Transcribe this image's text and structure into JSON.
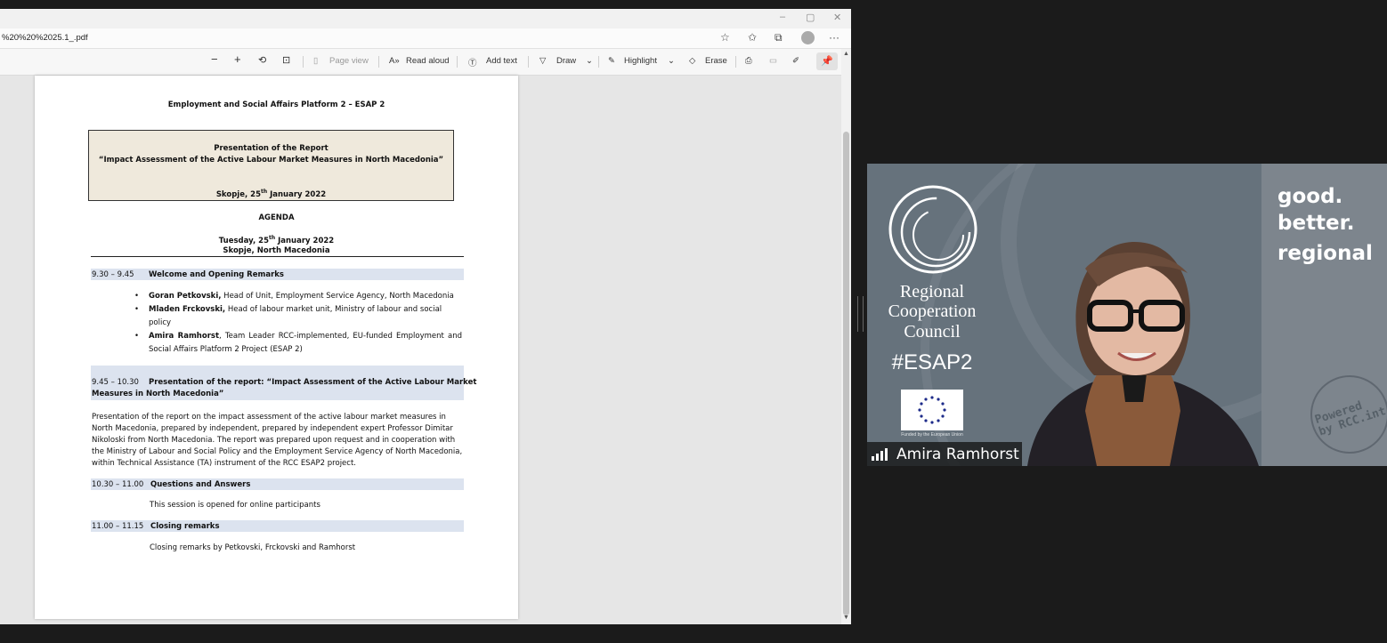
{
  "browser": {
    "url": "%20%20%2025.1_.pdf",
    "window_controls": [
      "–",
      "▢",
      "✕"
    ],
    "address_icons": [
      "favorite-add-icon",
      "favorites-icon",
      "collections-icon",
      "profile-icon",
      "more-icon"
    ],
    "more_label": "···"
  },
  "pdf_toolbar": {
    "zoom_out": "−",
    "zoom_in": "+",
    "page_view": "Page view",
    "read_aloud": "Read aloud",
    "add_text": "Add text",
    "draw": "Draw",
    "highlight": "Highlight",
    "erase": "Erase",
    "pin": "📌"
  },
  "document": {
    "header": "Employment and Social Affairs Platform 2 – ESAP 2",
    "box": {
      "line1": "Presentation of the Report",
      "line2": "“Impact Assessment of the Active Labour Market Measures in North Macedonia”",
      "place_date_prefix": "Skopje, 25",
      "place_date_sup": "th",
      "place_date_suffix": " January 2022"
    },
    "agenda_title": "AGENDA",
    "date_prefix": "Tuesday, 25",
    "date_sup": "th",
    "date_suffix": " January 2022",
    "location": "Skopje, North Macedonia",
    "sessions": [
      {
        "time": "9.30 – 9.45",
        "title": "Welcome and Opening Remarks",
        "speakers": [
          {
            "name": "Goran Petkovski,",
            "role": " Head of Unit, Employment Service Agency, North Macedonia"
          },
          {
            "name": "Mladen Frckovski,",
            "role": " Head of labour market unit, Ministry of labour and social policy"
          },
          {
            "name": "Amira Ramhorst",
            "role": ", Team Leader RCC-implemented, EU-funded Employment and Social Affairs Platform 2 Project (ESAP 2)"
          }
        ]
      },
      {
        "time": "9.45 – 10.30",
        "title": "Presentation of the report: “Impact Assessment of the Active Labour Market",
        "title_cont": "Measures in North Macedonia”",
        "description": "Presentation of the report on the impact assessment of the active labour market measures in North Macedonia, prepared by independent, prepared by independent expert Professor Dimitar Nikoloski from North Macedonia. The report was prepared upon request and in cooperation with the Ministry of Labour and Social Policy and the Employment Service Agency of North Macedonia, within Technical Assistance (TA) instrument of the RCC ESAP2 project."
      },
      {
        "time": "10.30 – 11.00",
        "title": "Questions and Answers",
        "note": "This session is opened for online participants"
      },
      {
        "time": "11.00 – 11.15",
        "title": "Closing remarks",
        "note": "Closing remarks by Petkovski, Frckovski and Ramhorst"
      }
    ]
  },
  "video": {
    "participant_name": "Amira Ramhorst",
    "org_line1": "Regional",
    "org_line2": "Cooperation",
    "org_line3": "Council",
    "hashtag": "#ESAP2",
    "eu_caption": "Funded by the European Union",
    "slogan": [
      "good.",
      "better.",
      "regional"
    ],
    "stamp_line1": "Powered",
    "stamp_line2": "by RCC.int",
    "colors": {
      "panel": "#66727c",
      "accent_panel": "#7d858d",
      "nameplate": "#141414"
    }
  }
}
